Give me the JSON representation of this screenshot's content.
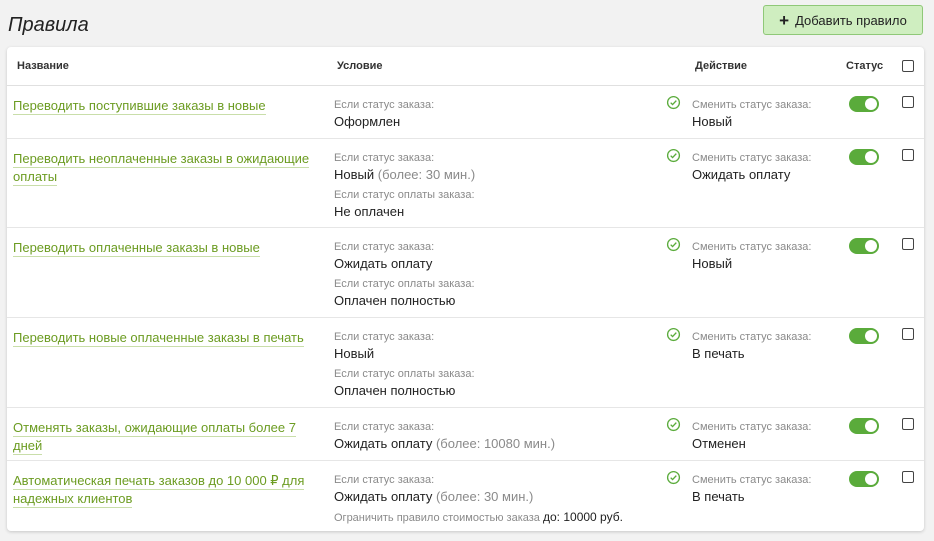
{
  "page": {
    "title": "Правила",
    "add_button_label": "Добавить правило"
  },
  "table": {
    "columns": {
      "name": "Название",
      "condition": "Условие",
      "action": "Действие",
      "status": "Статус"
    },
    "rows": [
      {
        "name": "Переводить поступившие заказы в новые",
        "order_status_label": "Если статус заказа:",
        "order_status": "Оформлен",
        "order_status_extra": "",
        "payment_status_label": "",
        "payment_status": "",
        "limit_label": "",
        "limit_value": "",
        "action_label": "Сменить статус заказа:",
        "action_value": "Новый",
        "enabled": true
      },
      {
        "name": "Переводить неоплаченные заказы в ожидающие оплаты",
        "order_status_label": "Если статус заказа:",
        "order_status": "Новый",
        "order_status_extra": "(более: 30 мин.)",
        "payment_status_label": "Если статус оплаты заказа:",
        "payment_status": "Не оплачен",
        "limit_label": "",
        "limit_value": "",
        "action_label": "Сменить статус заказа:",
        "action_value": "Ожидать оплату",
        "enabled": true
      },
      {
        "name": "Переводить оплаченные заказы в новые",
        "order_status_label": "Если статус заказа:",
        "order_status": "Ожидать оплату",
        "order_status_extra": "",
        "payment_status_label": "Если статус оплаты заказа:",
        "payment_status": "Оплачен полностью",
        "limit_label": "",
        "limit_value": "",
        "action_label": "Сменить статус заказа:",
        "action_value": "Новый",
        "enabled": true
      },
      {
        "name": "Переводить новые оплаченные заказы в печать",
        "order_status_label": "Если статус заказа:",
        "order_status": "Новый",
        "order_status_extra": "",
        "payment_status_label": "Если статус оплаты заказа:",
        "payment_status": "Оплачен полностью",
        "limit_label": "",
        "limit_value": "",
        "action_label": "Сменить статус заказа:",
        "action_value": "В печать",
        "enabled": true
      },
      {
        "name": "Отменять заказы, ожидающие оплаты более 7 дней",
        "order_status_label": "Если статус заказа:",
        "order_status": "Ожидать оплату",
        "order_status_extra": "(более: 10080 мин.)",
        "payment_status_label": "",
        "payment_status": "",
        "limit_label": "",
        "limit_value": "",
        "action_label": "Сменить статус заказа:",
        "action_value": "Отменен",
        "enabled": true
      },
      {
        "name": "Автоматическая печать заказов до 10 000 ₽ для надежных клиентов",
        "order_status_label": "Если статус заказа:",
        "order_status": "Ожидать оплату",
        "order_status_extra": "(более: 30 мин.)",
        "payment_status_label": "",
        "payment_status": "",
        "limit_label": "Ограничить правило стоимостью заказа",
        "limit_value": "до: 10000 руб.",
        "action_label": "Сменить статус заказа:",
        "action_value": "В печать",
        "enabled": true
      }
    ]
  },
  "colors": {
    "accent_green": "#5aab3b",
    "link_green": "#6c9c22",
    "add_button_bg": "#cfeec0"
  },
  "icons": {
    "add": "plus-icon",
    "condition_ok": "check-circle-icon"
  }
}
